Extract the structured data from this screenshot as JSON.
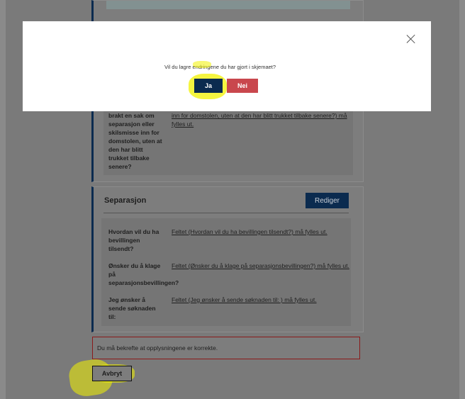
{
  "background_form": {
    "top_card": {
      "label_lines": [
        "brakt en sak om",
        "separasjon eller",
        "skilsmisse inn for",
        "domstolen, uten at",
        "den har blitt",
        "trukket tilbake",
        "senere?"
      ],
      "error_text_line1": "inn for domstolen, uten at den har blitt trukket tilbake senere?) må",
      "error_text_line2": "fylles ut."
    },
    "separasjon": {
      "title": "Separasjon",
      "edit_label": "Rediger",
      "rows": [
        {
          "label_lines": [
            "Hvordan vil du ha",
            "bevillingen",
            "tilsendt?"
          ],
          "error": "Feltet (Hvordan vil du ha bevillingen tilsendt?) må fylles ut."
        },
        {
          "label_lines": [
            "Ønsker du å klage",
            "på",
            "separasjonsbevillingen?"
          ],
          "error": "Feltet (Ønsker du å klage på separasjonsbevillingen?) må fylles ut."
        },
        {
          "label_lines": [
            "Jeg ønsker å",
            "sende søknaden",
            "til:"
          ],
          "error": "Feltet (Jeg ønsker å sende søknaden til: ) må fylles ut."
        }
      ]
    },
    "confirm_error": "Du må bekrefte at opplysningene er korrekte.",
    "cancel_label": "Avbryt"
  },
  "modal": {
    "question": "Vil du lagre endringene du har gjort i skjemaet?",
    "yes_label": "Ja",
    "no_label": "Nei",
    "close_icon": "close-icon"
  },
  "colors": {
    "primary": "#0b2b4f",
    "danger": "#c9474d",
    "highlight": "#f2f200"
  }
}
